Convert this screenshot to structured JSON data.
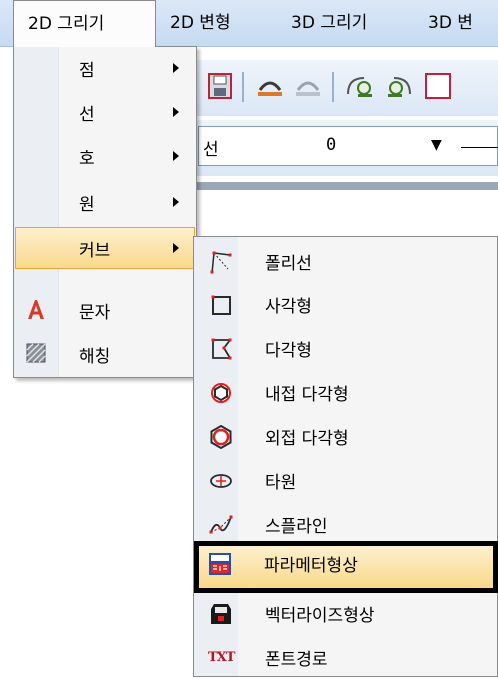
{
  "menubar": {
    "items": [
      {
        "label": "2D 그리기",
        "active": true
      },
      {
        "label": "2D 변형",
        "active": false
      },
      {
        "label": "3D 그리기",
        "active": false
      },
      {
        "label": "3D 변",
        "active": false
      }
    ]
  },
  "toolbar": {
    "icons": [
      "save-icon",
      "undo-icon",
      "redo-icon",
      "view-rotate-left-icon",
      "view-rotate-right-icon",
      "view-icon"
    ]
  },
  "properties": {
    "label": "선",
    "value": "0",
    "dropdown_arrow": "▼"
  },
  "menu": {
    "items": [
      {
        "label": "점",
        "has_submenu": true,
        "icon": ""
      },
      {
        "label": "선",
        "has_submenu": true,
        "icon": ""
      },
      {
        "label": "호",
        "has_submenu": true,
        "icon": ""
      },
      {
        "label": "원",
        "has_submenu": true,
        "icon": ""
      },
      {
        "label": "커브",
        "has_submenu": true,
        "icon": "",
        "highlighted": true
      },
      {
        "label": "문자",
        "has_submenu": false,
        "icon": "text-a-icon"
      },
      {
        "label": "해칭",
        "has_submenu": false,
        "icon": "hatch-icon"
      }
    ]
  },
  "submenu": {
    "items": [
      {
        "label": "폴리선",
        "icon": "polyline-icon"
      },
      {
        "label": "사각형",
        "icon": "rectangle-icon"
      },
      {
        "label": "다각형",
        "icon": "polygon-icon"
      },
      {
        "label": "내접 다각형",
        "icon": "inscribed-polygon-icon"
      },
      {
        "label": "외접 다각형",
        "icon": "circumscribed-polygon-icon"
      },
      {
        "label": "타원",
        "icon": "ellipse-icon"
      },
      {
        "label": "스플라인",
        "icon": "spline-icon"
      },
      {
        "label": "파라메터형상",
        "icon": "parametric-shape-icon",
        "highlighted": true
      },
      {
        "label": "벡터라이즈형상",
        "icon": "vectorize-shape-icon"
      },
      {
        "label": "폰트경로",
        "icon": "font-path-icon",
        "icon_text": "TXT"
      }
    ]
  },
  "colors": {
    "highlight_top": "#fdf0cf",
    "highlight_bottom": "#f9d98a",
    "highlight_border": "#e1a93a",
    "menubar": "#c6daf1",
    "icon_red": "#e02020"
  }
}
